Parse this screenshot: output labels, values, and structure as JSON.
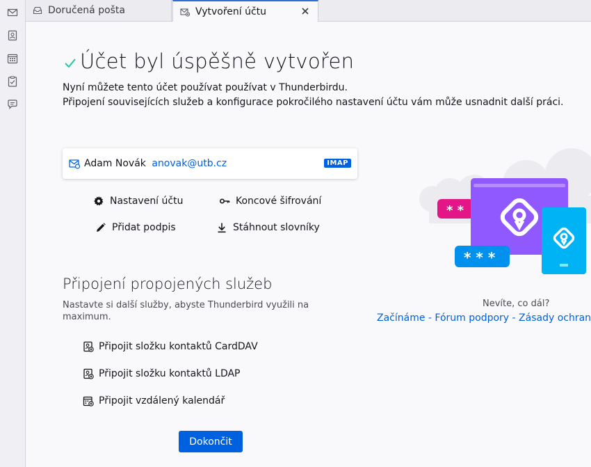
{
  "spaces": [
    {
      "name": "mail-icon"
    },
    {
      "name": "address-book-icon"
    },
    {
      "name": "calendar-icon"
    },
    {
      "name": "tasks-icon"
    },
    {
      "name": "chat-icon"
    }
  ],
  "tabs": [
    {
      "label": "Doručená pošta"
    },
    {
      "label": "Vytvoření účtu"
    }
  ],
  "header": {
    "title": "Účet byl úspěšně vytvořen",
    "line1": "Nyní můžete tento účet používat používat v Thunderbirdu.",
    "line2": "Připojení souvisejících služeb a konfigurace pokročilého nastavení účtu vám může usnadnit další práci."
  },
  "account": {
    "name": "Adam Novák",
    "email": "anovak@utb.cz",
    "protocol": "IMAP"
  },
  "actions": {
    "settings": "Nastavení účtu",
    "e2ee": "Koncové šifrování",
    "signature": "Přidat podpis",
    "dictionaries": "Stáhnout slovníky"
  },
  "services": {
    "title": "Připojení propojených služeb",
    "description": "Nastavte si další služby, abyste Thunderbird využili na maximum.",
    "carddav": "Připojit složku kontaktů CardDAV",
    "ldap": "Připojit složku kontaktů LDAP",
    "calendar": "Připojit vzdálený kalendář"
  },
  "finish_label": "Dokončit",
  "help": {
    "question": "Nevíte, co dál?",
    "link_start": "Začínáme",
    "link_support": "Fórum podpory",
    "link_privacy": "Zásady ochrany o",
    "separator": " - "
  },
  "colors": {
    "accent": "#0061e0",
    "success": "#2ac3a2",
    "purple": "#9059ff",
    "pink": "#e31587",
    "cyan": "#00b3f4"
  }
}
